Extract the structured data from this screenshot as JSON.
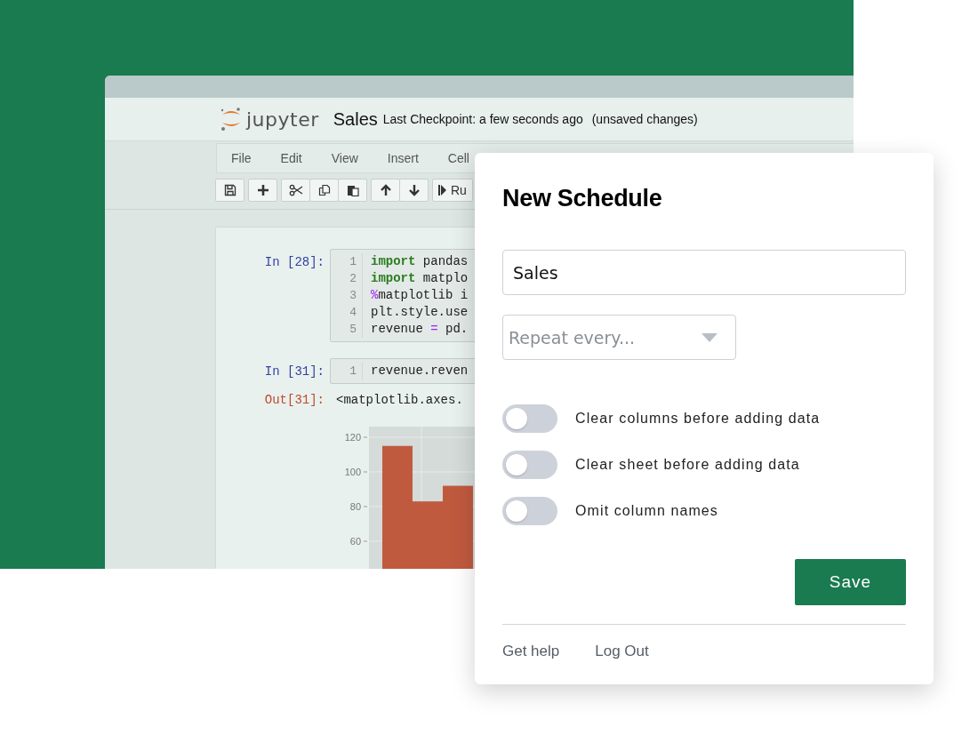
{
  "notebook": {
    "logo_text": "jupyter",
    "name": "Sales",
    "checkpoint": "Last Checkpoint: a few seconds ago",
    "status": "(unsaved changes)"
  },
  "menu": [
    "File",
    "Edit",
    "View",
    "Insert",
    "Cell"
  ],
  "toolbar": [
    [
      {
        "kind": "save"
      }
    ],
    [
      {
        "kind": "add"
      }
    ],
    [
      {
        "kind": "cut"
      },
      {
        "kind": "copy"
      },
      {
        "kind": "paste"
      }
    ],
    [
      {
        "kind": "up"
      },
      {
        "kind": "down"
      }
    ],
    [
      {
        "kind": "run",
        "label": "Ru"
      }
    ]
  ],
  "cells": [
    {
      "kind": "input",
      "prompt": "In [28]:",
      "lines": [
        {
          "number": "1",
          "tokens": [
            {
              "kind": "keyword",
              "text": "import"
            },
            {
              "kind": "plain",
              "text": " pandas"
            }
          ]
        },
        {
          "number": "2",
          "tokens": [
            {
              "kind": "keyword",
              "text": "import"
            },
            {
              "kind": "plain",
              "text": " matplo"
            }
          ]
        },
        {
          "number": "3",
          "tokens": [
            {
              "kind": "operator",
              "text": "%"
            },
            {
              "kind": "plain",
              "text": "matplotlib i"
            }
          ]
        },
        {
          "number": "4",
          "tokens": [
            {
              "kind": "plain",
              "text": "plt.style.use"
            }
          ]
        },
        {
          "number": "5",
          "tokens": [
            {
              "kind": "plain",
              "text": "revenue "
            },
            {
              "kind": "operator",
              "text": "="
            },
            {
              "kind": "plain",
              "text": " pd."
            }
          ]
        }
      ]
    },
    {
      "kind": "input",
      "prompt": "In [31]:",
      "lines": [
        {
          "number": "1",
          "tokens": [
            {
              "kind": "plain",
              "text": "revenue.reven"
            }
          ]
        }
      ]
    },
    {
      "kind": "output",
      "prompt": "Out[31]:",
      "text": "<matplotlib.axes.",
      "chart_data": {
        "type": "bar",
        "values": [
          115,
          83,
          92
        ],
        "ylim": [
          44,
          120
        ],
        "yticks": [
          60,
          80,
          100,
          120
        ],
        "grid": true
      }
    }
  ],
  "dialog": {
    "title": "New Schedule",
    "name_value": "Sales",
    "repeat_placeholder": "Repeat every...",
    "toggles": [
      {
        "label": "Clear columns before adding data",
        "on": false
      },
      {
        "label": "Clear sheet before adding data",
        "on": false
      },
      {
        "label": "Omit column names",
        "on": false
      }
    ],
    "save": "Save",
    "links": [
      "Get help",
      "Log Out"
    ]
  }
}
